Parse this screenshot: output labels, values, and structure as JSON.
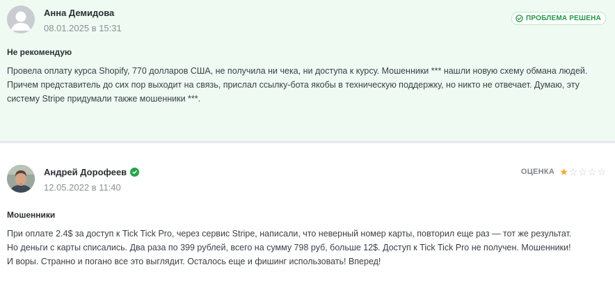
{
  "reviews": [
    {
      "author": "Анна Демидова",
      "date": "08.01.2025 в 15:31",
      "badge": "ПРОБЛЕМА РЕШЕНА",
      "title": "Не рекомендую",
      "body_lines": [
        "Провела оплату курса Shopify, 770 долларов США, не получила ни чека, ни доступа к курсу. Мошенники *** нашли новую схему обмана людей.",
        "Причем представитель до сих пор выходит на связь, прислал ссылку-бота якобы в техническую поддержку, но никто не отвечает. Думаю, эту",
        "систему Stripe придумали также мошенники ***."
      ]
    },
    {
      "author": "Андрей Дорофеев",
      "date": "12.05.2022 в 11:40",
      "rating_label": "ОЦЕНКА",
      "rating": 1,
      "rating_max": 5,
      "title": "Мошенники",
      "body_lines": [
        "При оплате 2.4$ за доступ к Tick Tick Pro, через сервис Stripe, написали, что неверный номер карты, повторил еще раз — тот же результат.",
        "Но деньги с карты списались. Два раза по 399 рублей, всего на сумму 798 руб, больше 12$. Доступ к Tick Tick Pro не получен. Мошенники!",
        "И воры. Странно и погано все это выглядит. Осталось еще и фишинг использовать! Вперед!"
      ]
    }
  ],
  "colors": {
    "resolved_bg": "#effaf3",
    "resolved_badge": "#1e9a45",
    "verified": "#21a649",
    "star_on": "#f0a824",
    "star_off": "#c9ccd0"
  },
  "icons": {
    "badge": "check-circle-icon",
    "verified": "verified-check-icon",
    "avatar_1": "default-avatar",
    "star": "star-icon"
  }
}
